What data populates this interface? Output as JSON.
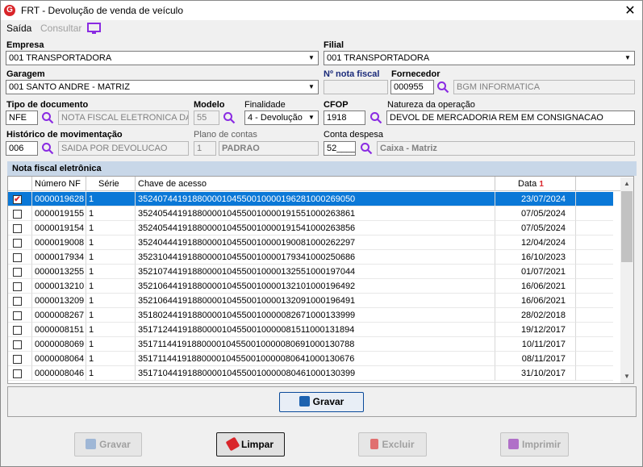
{
  "window": {
    "title": "FRT - Devolução de venda de veículo",
    "logo": "G",
    "close": "✕"
  },
  "menu": {
    "saida": "Saída",
    "consultar": "Consultar"
  },
  "form": {
    "empresa": {
      "label": "Empresa",
      "value": "001 TRANSPORTADORA"
    },
    "filial": {
      "label": "Filial",
      "value": "001 TRANSPORTADORA"
    },
    "garagem": {
      "label": "Garagem",
      "value": "001 SANTO ANDRE - MATRIZ"
    },
    "nota_fiscal": {
      "label": "Nº nota fiscal",
      "value": ""
    },
    "fornecedor": {
      "label": "Fornecedor",
      "code": "000955",
      "name": "BGM INFORMATICA"
    },
    "tipo_documento": {
      "label": "Tipo de documento",
      "code": "NFE",
      "name": "NOTA FISCAL ELETRONICA DA"
    },
    "modelo": {
      "label": "Modelo",
      "value": "55"
    },
    "finalidade": {
      "label": "Finalidade",
      "value": "4 - Devolução"
    },
    "cfop": {
      "label": "CFOP",
      "value": "1918"
    },
    "natureza": {
      "label": "Natureza da operação",
      "value": "DEVOL DE MERCADORIA REM EM CONSIGNACAO"
    },
    "historico": {
      "label": "Histórico de movimentação",
      "code": "006",
      "name": "SAIDA POR DEVOLUCAO"
    },
    "plano_contas": {
      "label": "Plano de contas",
      "code": "1",
      "name": "PADRAO"
    },
    "conta_despesa": {
      "label": "Conta despesa",
      "code": "52____",
      "name": "Caixa - Matriz"
    }
  },
  "grid": {
    "title": "Nota fiscal eletrônica",
    "columns": {
      "numero": "Número NF",
      "serie": "Série",
      "chave": "Chave de acesso",
      "data": "Data",
      "sort": "1"
    },
    "rows": [
      {
        "checked": true,
        "numero": "0000019628",
        "serie": "1",
        "chave": "35240744191880000104550010000196281000269050",
        "data": "23/07/2024"
      },
      {
        "checked": false,
        "numero": "0000019155",
        "serie": "1",
        "chave": "35240544191880000104550010000191551000263861",
        "data": "07/05/2024"
      },
      {
        "checked": false,
        "numero": "0000019154",
        "serie": "1",
        "chave": "35240544191880000104550010000191541000263856",
        "data": "07/05/2024"
      },
      {
        "checked": false,
        "numero": "0000019008",
        "serie": "1",
        "chave": "35240444191880000104550010000190081000262297",
        "data": "12/04/2024"
      },
      {
        "checked": false,
        "numero": "0000017934",
        "serie": "1",
        "chave": "35231044191880000104550010000179341000250686",
        "data": "16/10/2023"
      },
      {
        "checked": false,
        "numero": "0000013255",
        "serie": "1",
        "chave": "35210744191880000104550010000132551000197044",
        "data": "01/07/2021"
      },
      {
        "checked": false,
        "numero": "0000013210",
        "serie": "1",
        "chave": "35210644191880000104550010000132101000196492",
        "data": "16/06/2021"
      },
      {
        "checked": false,
        "numero": "0000013209",
        "serie": "1",
        "chave": "35210644191880000104550010000132091000196491",
        "data": "16/06/2021"
      },
      {
        "checked": false,
        "numero": "0000008267",
        "serie": "1",
        "chave": "35180244191880000104550010000082671000133999",
        "data": "28/02/2018"
      },
      {
        "checked": false,
        "numero": "0000008151",
        "serie": "1",
        "chave": "35171244191880000104550010000081511000131894",
        "data": "19/12/2017"
      },
      {
        "checked": false,
        "numero": "0000008069",
        "serie": "1",
        "chave": "35171144191880000104550010000080691000130788",
        "data": "10/11/2017"
      },
      {
        "checked": false,
        "numero": "0000008064",
        "serie": "1",
        "chave": "35171144191880000104550010000080641000130676",
        "data": "08/11/2017"
      },
      {
        "checked": false,
        "numero": "0000008046",
        "serie": "1",
        "chave": "35171044191880000104550010000080461000130399",
        "data": "31/10/2017"
      }
    ]
  },
  "buttons": {
    "gravar_grid": "Gravar",
    "gravar": "Gravar",
    "limpar": "Limpar",
    "excluir": "Excluir",
    "imprimir": "Imprimir"
  }
}
